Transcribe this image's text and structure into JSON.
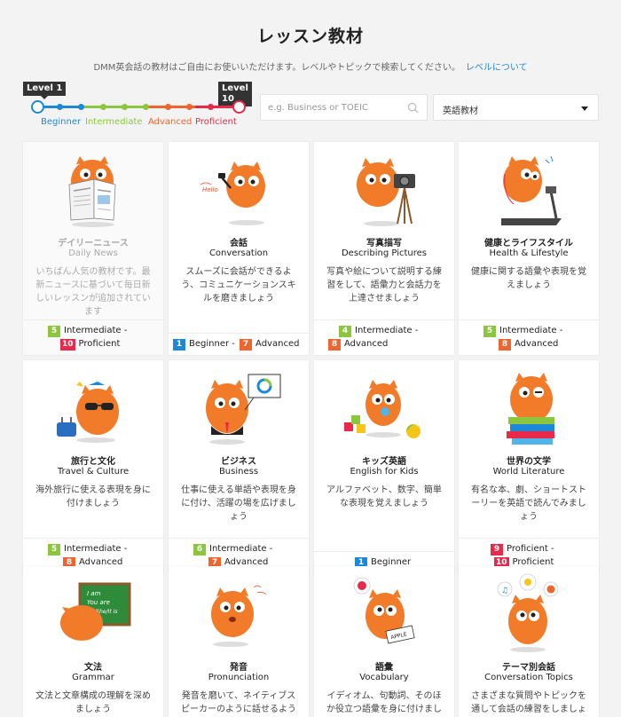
{
  "header": {
    "title": "レッスン教材",
    "intro": "DMM英会話の教材はご自由にお使いいただけます。レベルやトピックで検索してください。",
    "level_link": "レベルについて"
  },
  "slider": {
    "left_tag": "Level 1",
    "right_tag": "Level 10",
    "stages": [
      "Beginner",
      "Intermediate",
      "Advanced",
      "Proficient"
    ],
    "colors": {
      "beginner": "#1e88d8",
      "intermediate": "#8cc63f",
      "advanced": "#f0642d",
      "proficient": "#e8294a"
    }
  },
  "search": {
    "placeholder": "e.g. Business or TOEIC",
    "icon": "search-icon"
  },
  "category_select": {
    "value": "英語教材"
  },
  "cards": [
    {
      "title": "デイリーニュース",
      "subtitle": "Daily News",
      "desc": "いちばん人気の教材です。最新ニュースに基づいて毎日新しいレッスンが追加されています",
      "level_from": {
        "num": "5",
        "label": "Intermediate"
      },
      "level_to": {
        "num": "10",
        "label": "Proficient"
      }
    },
    {
      "title": "会話",
      "subtitle": "Conversation",
      "desc": "スムーズに会話ができるよう、コミュニケーションスキルを磨きましょう",
      "level_from": {
        "num": "1",
        "label": "Beginner"
      },
      "level_to": {
        "num": "7",
        "label": "Advanced"
      },
      "art_text": "Hello"
    },
    {
      "title": "写真描写",
      "subtitle": "Describing Pictures",
      "desc": "写真や絵について説明する練習をして、語彙力と会話力を上達させましょう",
      "level_from": {
        "num": "4",
        "label": "Intermediate"
      },
      "level_to": {
        "num": "8",
        "label": "Advanced"
      }
    },
    {
      "title": "健康とライフスタイル",
      "subtitle": "Health & Lifestyle",
      "desc": "健康に関する語彙や表現を覚えましょう",
      "level_from": {
        "num": "5",
        "label": "Intermediate"
      },
      "level_to": {
        "num": "8",
        "label": "Advanced"
      }
    },
    {
      "title": "旅行と文化",
      "subtitle": "Travel & Culture",
      "desc": "海外旅行に使える表現を身に付けましょう",
      "level_from": {
        "num": "5",
        "label": "Intermediate"
      },
      "level_to": {
        "num": "8",
        "label": "Advanced"
      }
    },
    {
      "title": "ビジネス",
      "subtitle": "Business",
      "desc": "仕事に使える単語や表現を身に付け、活躍の場を広げましょう",
      "level_from": {
        "num": "6",
        "label": "Intermediate"
      },
      "level_to": {
        "num": "7",
        "label": "Advanced"
      }
    },
    {
      "title": "キッズ英語",
      "subtitle": "English for Kids",
      "desc": "アルファベット、数字、簡単な表現を覚えましょう",
      "level_from": {
        "num": "1",
        "label": "Beginner"
      }
    },
    {
      "title": "世界の文学",
      "subtitle": "World Literature",
      "desc": "有名な本、劇、ショートストーリーを英語で読んでみましょう",
      "level_from": {
        "num": "9",
        "label": "Proficient"
      },
      "level_to": {
        "num": "10",
        "label": "Proficient"
      }
    },
    {
      "title": "文法",
      "subtitle": "Grammar",
      "desc": "文法と文章構成の理解を深めましょう",
      "art_text": [
        "I am",
        "You are",
        "He/She/It is"
      ]
    },
    {
      "title": "発音",
      "subtitle": "Pronunciation",
      "desc": "発音を磨いて、ネイティブスピーカーのように話せるように"
    },
    {
      "title": "語彙",
      "subtitle": "Vocabulary",
      "desc": "イディオム、句動詞、そのほか役立つ語彙を身に付けまし",
      "art_text": "APPLE"
    },
    {
      "title": "テーマ別会話",
      "subtitle": "Conversation Topics",
      "desc": "さまざまな質問やトピックを通して会話の練習をしましょ"
    }
  ]
}
